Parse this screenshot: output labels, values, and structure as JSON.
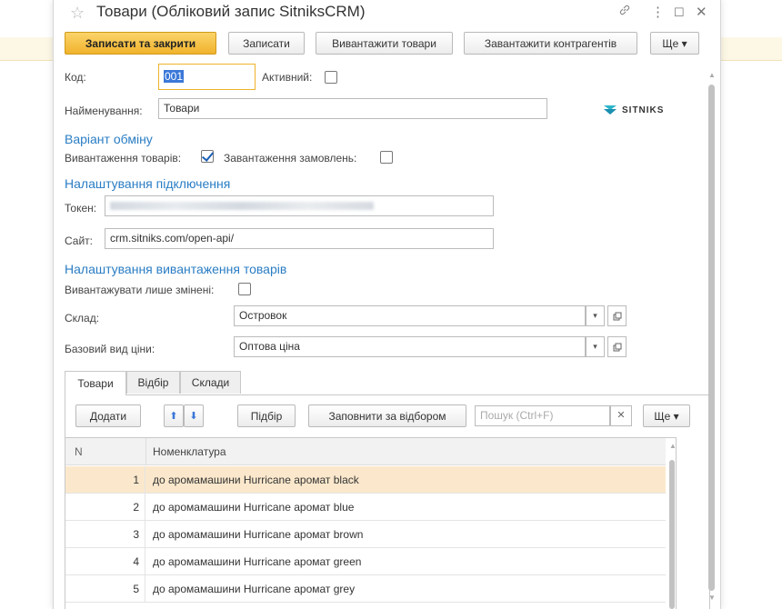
{
  "window": {
    "title": "Товари (Обліковий запис SitniksCRM)"
  },
  "toolbar": {
    "save_close": "Записати та закрити",
    "save": "Записати",
    "export_goods": "Вивантажити товари",
    "import_contractors": "Завантажити контрагентів",
    "more": "Ще ▾"
  },
  "form": {
    "code_label": "Код:",
    "code_value": "001",
    "active_label": "Активний:",
    "name_label": "Найменування:",
    "name_value": "Товари",
    "logo_text": "SITNIKS",
    "exchange_section": "Варіант обміну",
    "export_goods_label": "Вивантаження товарів:",
    "import_orders_label": "Завантаження замовлень:",
    "connection_section": "Налаштування підключення",
    "token_label": "Токен:",
    "site_label": "Сайт:",
    "site_value": "crm.sitniks.com/open-api/",
    "export_settings_section": "Налаштування вивантаження товарів",
    "only_changed_label": "Вивантажувати лише змінені:",
    "warehouse_label": "Склад:",
    "warehouse_value": "Островок",
    "price_label": "Базовий вид ціни:",
    "price_value": "Оптова ціна"
  },
  "tabs": [
    {
      "label": "Товари"
    },
    {
      "label": "Відбір"
    },
    {
      "label": "Склади"
    }
  ],
  "table_toolbar": {
    "add": "Додати",
    "pick": "Підбір",
    "fill_by_filter": "Заповнити за відбором",
    "search_placeholder": "Пошук (Ctrl+F)",
    "more": "Ще ▾"
  },
  "table": {
    "columns": [
      "N",
      "Номенклатура"
    ],
    "rows": [
      {
        "n": "1",
        "name": "до аромамашини Hurricane аромат black"
      },
      {
        "n": "2",
        "name": "до аромамашини Hurricane аромат blue"
      },
      {
        "n": "3",
        "name": "до аромамашини Hurricane аромат brown"
      },
      {
        "n": "4",
        "name": "до аромамашини Hurricane аромат green"
      },
      {
        "n": "5",
        "name": "до аромамашини Hurricane аромат grey"
      }
    ]
  },
  "colors": {
    "accent": "#f0b32c",
    "section": "#2a7dc4",
    "selected_row": "#fbe8cc"
  },
  "icons": [
    "star-icon",
    "link-icon",
    "menu-icon",
    "maximize-icon",
    "close-icon",
    "arrow-up-icon",
    "arrow-down-icon",
    "clear-icon",
    "dropdown-icon",
    "open-icon"
  ]
}
